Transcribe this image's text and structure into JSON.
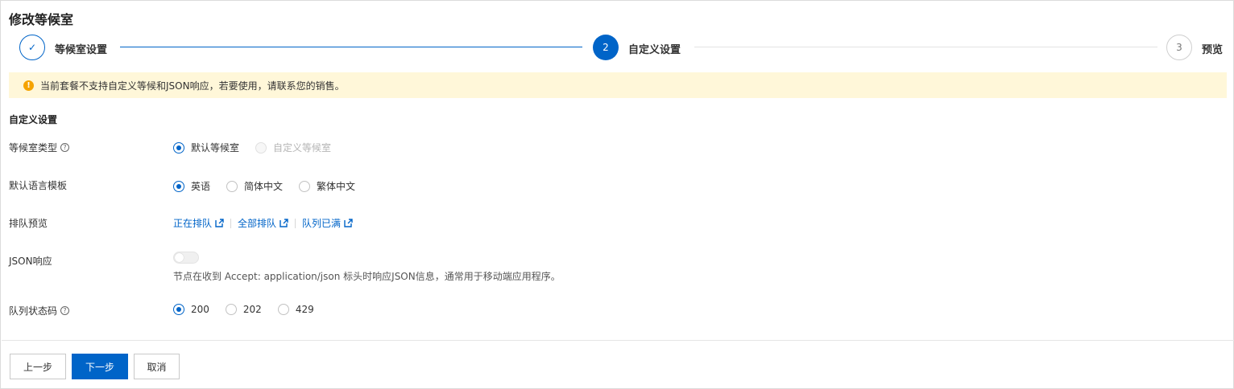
{
  "page": {
    "title": "修改等候室"
  },
  "steps": [
    {
      "label": "等候室设置",
      "state": "done",
      "marker": "✓"
    },
    {
      "label": "自定义设置",
      "state": "active",
      "marker": "2"
    },
    {
      "label": "预览",
      "state": "pending",
      "marker": "3"
    }
  ],
  "warning": {
    "text": "当前套餐不支持自定义等候和JSON响应，若要使用，请联系您的销售。",
    "icon": "!"
  },
  "section": {
    "title": "自定义设置"
  },
  "form": {
    "waiting_room_type": {
      "label": "等候室类型",
      "help": "?",
      "options": [
        {
          "label": "默认等候室",
          "selected": true,
          "disabled": false
        },
        {
          "label": "自定义等候室",
          "selected": false,
          "disabled": true
        }
      ]
    },
    "language_template": {
      "label": "默认语言模板",
      "options": [
        {
          "label": "英语",
          "selected": true
        },
        {
          "label": "简体中文",
          "selected": false
        },
        {
          "label": "繁体中文",
          "selected": false
        }
      ]
    },
    "queue_preview": {
      "label": "排队预览",
      "links": [
        "正在排队",
        "全部排队",
        "队列已满"
      ]
    },
    "json_response": {
      "label": "JSON响应",
      "enabled": false,
      "hint": "节点在收到 Accept: application/json 标头时响应JSON信息，通常用于移动端应用程序。"
    },
    "queue_status_code": {
      "label": "队列状态码",
      "help": "?",
      "options": [
        {
          "label": "200",
          "selected": true
        },
        {
          "label": "202",
          "selected": false
        },
        {
          "label": "429",
          "selected": false
        }
      ]
    }
  },
  "footer": {
    "prev": "上一步",
    "next": "下一步",
    "cancel": "取消"
  },
  "colors": {
    "primary": "#0064c8",
    "warning_bg": "#fff7d9",
    "warning_icon": "#f5a300"
  }
}
